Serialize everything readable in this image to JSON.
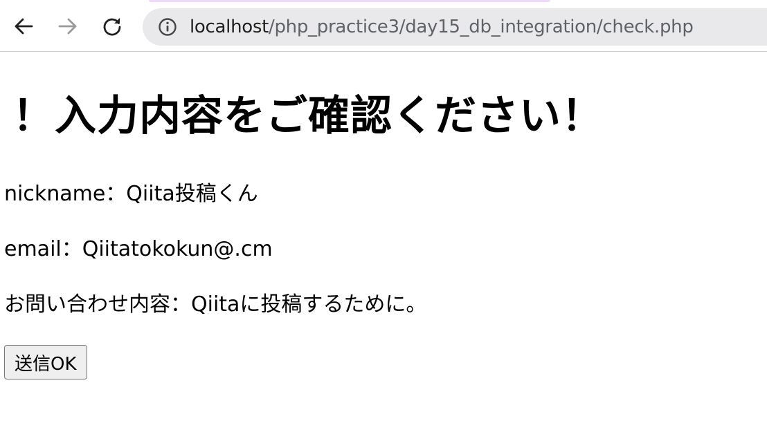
{
  "browser": {
    "url_host": "localhost",
    "url_path": "/php_practice3/day15_db_integration/check.php",
    "icons": {
      "back": "arrow-left-icon",
      "forward": "arrow-right-icon",
      "reload": "reload-icon",
      "info": "info-icon"
    }
  },
  "page": {
    "title": "！入力内容をご確認ください！",
    "nickname_line": "nickname：Qiita投稿くん",
    "email_line": "email：Qiitatokokun@.cm",
    "inquiry_line": "お問い合わせ内容：Qiitaに投稿するために。",
    "submit_label": "送信OK"
  },
  "colors": {
    "address_bar_bg": "#e9e9eb",
    "url_host": "#1f1f1f",
    "url_path": "#5f6368",
    "button_bg": "#efefef"
  }
}
